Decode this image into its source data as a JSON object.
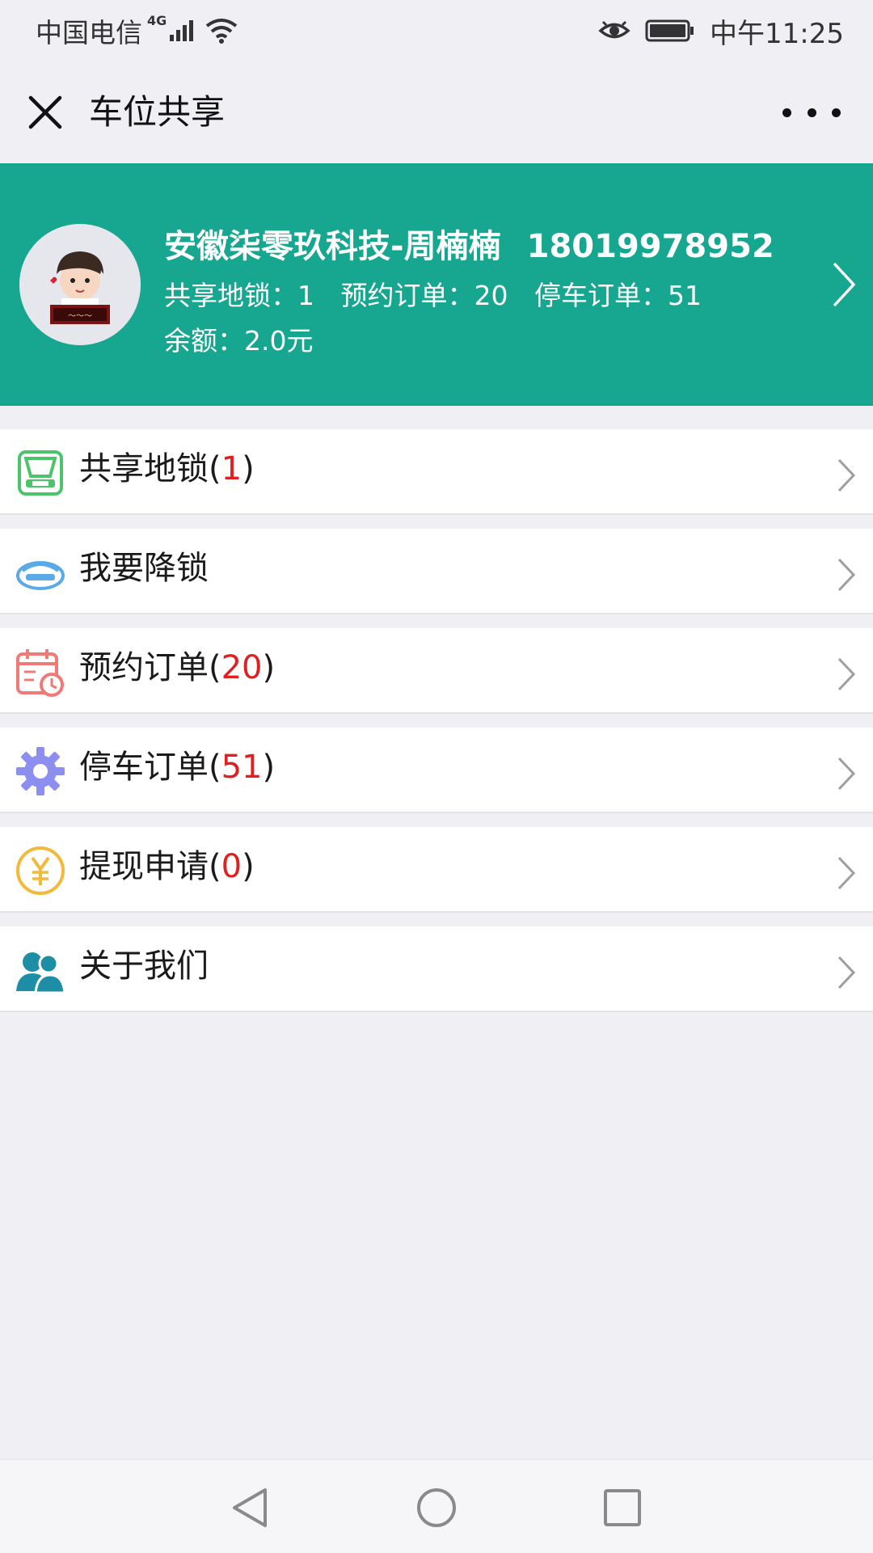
{
  "status_bar": {
    "carrier": "中国电信",
    "network": "4G",
    "time": "中午11:25"
  },
  "nav": {
    "title": "车位共享"
  },
  "profile": {
    "name": "安徽柒零玖科技-周楠楠",
    "phone": "18019978952",
    "stats": {
      "locks_label": "共享地锁：",
      "locks_value": "1",
      "reserve_label": "预约订单：",
      "reserve_value": "20",
      "parking_label": "停车订单：",
      "parking_value": "51"
    },
    "balance_label": "余额：",
    "balance_value": "2.0元"
  },
  "menu": [
    {
      "label": "共享地锁",
      "count": "1",
      "icon": "floor-lock-icon",
      "color": "#4cc56a"
    },
    {
      "label": "我要降锁",
      "count": null,
      "icon": "lower-lock-icon",
      "color": "#5aaae8"
    },
    {
      "label": "预约订单",
      "count": "20",
      "icon": "calendar-clock-icon",
      "color": "#f07a76"
    },
    {
      "label": "停车订单",
      "count": "51",
      "icon": "gear-icon",
      "color": "#8d8ff0"
    },
    {
      "label": "提现申请",
      "count": "0",
      "icon": "yen-coin-icon",
      "color": "#f2b93b"
    },
    {
      "label": "关于我们",
      "count": null,
      "icon": "users-icon",
      "color": "#1d8ea6"
    }
  ],
  "colors": {
    "header_bg": "#17a68f",
    "count_red": "#e02020",
    "page_bg": "#efeff4"
  }
}
